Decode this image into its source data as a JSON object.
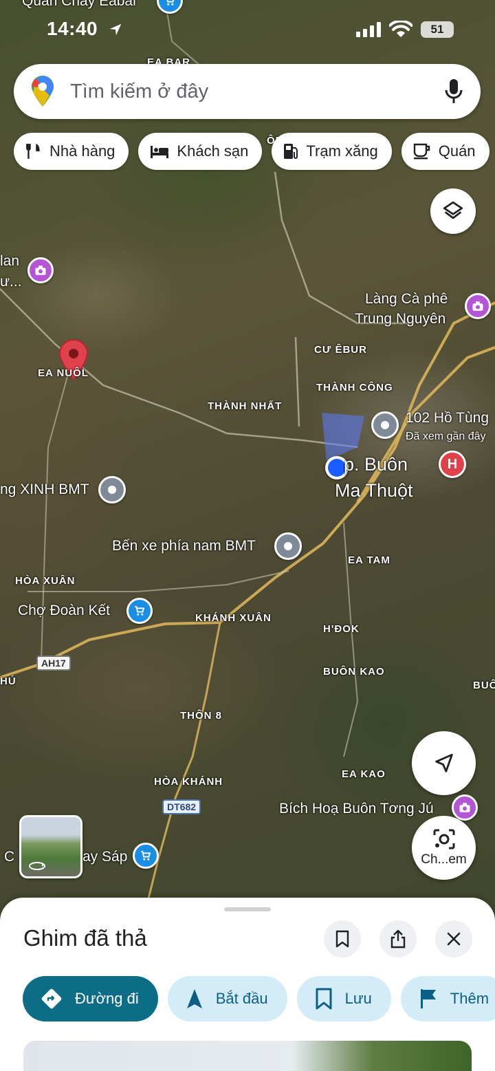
{
  "status_bar": {
    "time": "14:40",
    "battery": "51"
  },
  "search": {
    "placeholder": "Tìm kiếm ở đây"
  },
  "chips": [
    {
      "label": "Nhà hàng",
      "icon": "restaurant-icon"
    },
    {
      "label": "Khách sạn",
      "icon": "hotel-icon"
    },
    {
      "label": "Trạm xăng",
      "icon": "gas-station-icon"
    },
    {
      "label": "Quán",
      "icon": "cafe-icon"
    }
  ],
  "map": {
    "labels": {
      "quan_chay": "Quán Chay Eabal",
      "ea_bar": "EA BAR",
      "thon": "ÔN",
      "lan": "lan",
      "lan_2": "ư...",
      "lang_ca_phe": "Làng Cà phê",
      "trung_nguyen": "Trung Nguyên",
      "cu_ebur": "CƯ ÊBUR",
      "ea_nuol": "EA NUÔL",
      "thanh_cong": "THÀNH CÔNG",
      "thanh_nhat": "THÀNH NHẤT",
      "ho_tung": "102 Hồ Tùng",
      "da_xem": "Đã xem gần đây",
      "city_1": "p. Buôn",
      "city_2": "Ma Thuột",
      "xinh_bmt": "ng XINH BMT",
      "ben_xe": "Bến xe phía nam BMT",
      "ea_tam": "EA TAM",
      "hoa_xuan": "HÒA XUÂN",
      "cho_doan_ket": "Chợ Đoàn Kết",
      "khanh_xuan": "KHÁNH XUÂN",
      "h_dok": "H'ĐOK",
      "buon_kao": "BUÔN KAO",
      "buo": "BUÔ",
      "hu": "HÚ",
      "thon_8": "THÔN 8",
      "ea_kao": "EA KAO",
      "hoa_khanh": "HÒA KHÁNH",
      "bich_hoa": "Bích Hoạ Buôn Tơng Jú",
      "cho_sap_1": "C",
      "cho_sap_2": "ay Sáp"
    },
    "shields": {
      "ah17": "AH17",
      "dt682": "DT682"
    },
    "hospital_letter": "H"
  },
  "lens_button": {
    "label": "Ch...em"
  },
  "sheet": {
    "title": "Ghim đã thả",
    "actions": [
      {
        "label": "Đường đi",
        "icon": "directions-icon"
      },
      {
        "label": "Bắt đầu",
        "icon": "navigation-arrow-icon"
      },
      {
        "label": "Lưu",
        "icon": "bookmark-icon"
      },
      {
        "label": "Thêm",
        "icon": "flag-icon"
      }
    ]
  },
  "colors": {
    "primary": "#0d6d86",
    "chip_bg": "#d3ecf7",
    "pin_red": "#e0424c",
    "location_blue": "#1a73e8"
  }
}
